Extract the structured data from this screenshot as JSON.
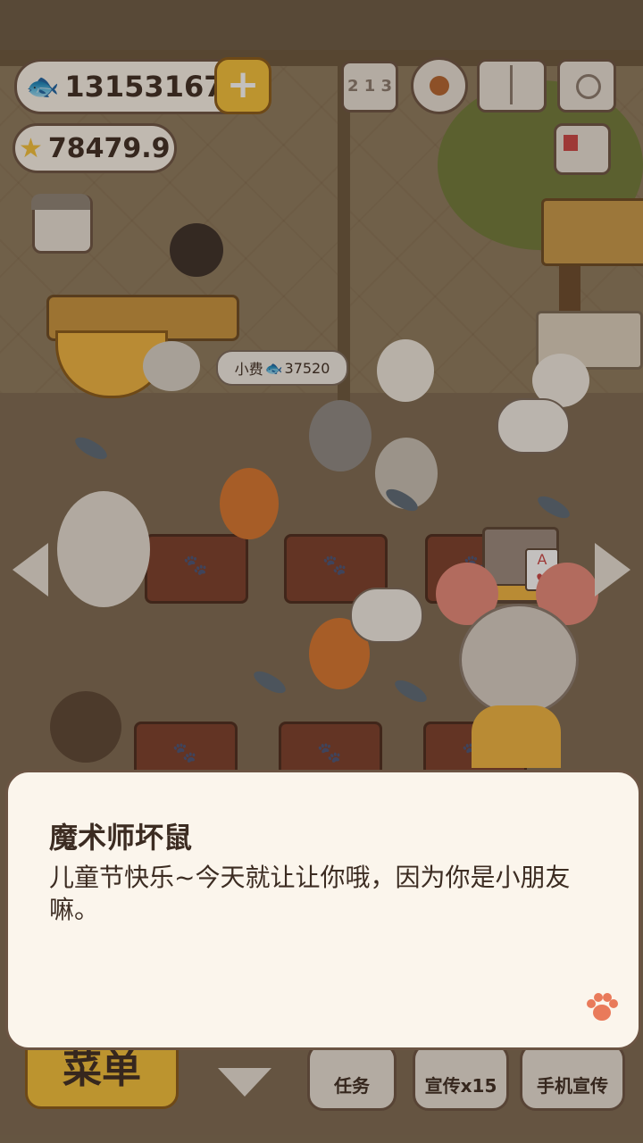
{
  "currency": {
    "fish_amount": "13153167",
    "star_amount": "78479.9"
  },
  "scene": {
    "tip_label": "小费",
    "tip_amount": "37520"
  },
  "dialog": {
    "speaker": "魔术师坏鼠",
    "text": "儿童节快乐~今天就让让你哦，因为你是小朋友嘛。"
  },
  "bottom_bar": {
    "menu_label": "菜单",
    "task_label": "任务",
    "promo_label": "宣传x15",
    "phone_promo_label": "手机宣传"
  },
  "colors": {
    "panel_bg": "#fbf5ec",
    "border": "#6b5443",
    "text": "#3c2c22",
    "accent_yellow": "#f5c33a"
  }
}
